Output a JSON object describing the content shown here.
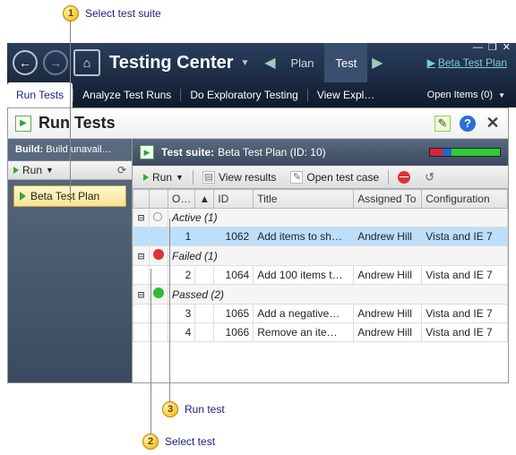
{
  "callouts": {
    "c1": {
      "num": "1",
      "text": "Select test suite"
    },
    "c2": {
      "num": "2",
      "text": "Select test"
    },
    "c3": {
      "num": "3",
      "text": "Run test"
    }
  },
  "titlebar": {
    "title": "Testing Center",
    "tabs": {
      "plan": "Plan",
      "test": "Test"
    },
    "plan_link": "Beta Test Plan"
  },
  "win": {
    "min": "—",
    "restore": "❐",
    "close": "✕"
  },
  "subnav": {
    "run_tests": "Run Tests",
    "analyze": "Analyze Test Runs",
    "exploratory": "Do Exploratory Testing",
    "view": "View Expl…",
    "open_items": "Open Items (0)"
  },
  "workspace": {
    "title": "Run Tests"
  },
  "left": {
    "build_label": "Build:",
    "build_value": "Build unavail…",
    "run": "Run",
    "suite": "Beta Test Plan"
  },
  "suite_header": {
    "label": "Test suite:",
    "name": "Beta Test Plan (ID: 10)"
  },
  "toolbar": {
    "run": "Run",
    "view_results": "View results",
    "open_case": "Open test case"
  },
  "columns": {
    "order": "O…",
    "id": "ID",
    "title": "Title",
    "assigned": "Assigned To",
    "config": "Configuration"
  },
  "groups": {
    "active": "Active (1)",
    "failed": "Failed (1)",
    "passed": "Passed (2)"
  },
  "rows": [
    {
      "order": "1",
      "id": "1062",
      "title": "Add items to sh…",
      "assigned": "Andrew Hill",
      "config": "Vista and IE 7"
    },
    {
      "order": "2",
      "id": "1064",
      "title": "Add 100 items t…",
      "assigned": "Andrew Hill",
      "config": "Vista and IE 7"
    },
    {
      "order": "3",
      "id": "1065",
      "title": "Add a negative…",
      "assigned": "Andrew Hill",
      "config": "Vista and IE 7"
    },
    {
      "order": "4",
      "id": "1066",
      "title": "Remove an ite…",
      "assigned": "Andrew Hill",
      "config": "Vista and IE 7"
    }
  ]
}
